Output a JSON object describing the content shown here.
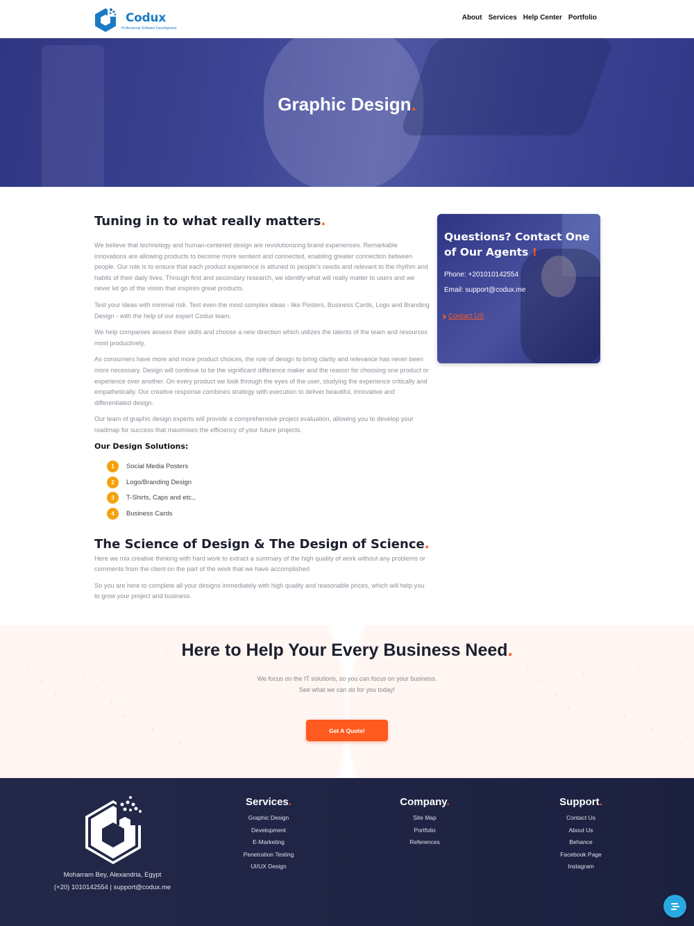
{
  "brand": {
    "name": "Codux",
    "tagline": "Professional Software Development",
    "accent": "#ff5a1f",
    "brand_blue": "#1a7bc4"
  },
  "nav": {
    "items": [
      "About",
      "Services",
      "Help Center",
      "Portfolio"
    ]
  },
  "hero": {
    "title": "Graphic Design",
    "dot": "."
  },
  "main": {
    "title": "Tuning in to what really matters",
    "paragraphs": [
      "We believe that technology and human-centered design are revolutionizing brand experiences. Remarkable innovations are allowing products to become more sentient and connected, enabling greater connection between people. Our role is to ensure that each product experience is attuned to people's needs and relevant to the rhythm and habits of their daily lives. Through first and secondary research, we identify what will really matter to users and we never let go of the vision that inspires great products.",
      "Test your ideas with minimal risk. Test even the most complex ideas - like Posters, Business Cards, Logo and Branding Design - with the help of our expert Codux team.",
      "We help companies assess their skills and choose a new direction which utilizes the talents of the team and resources most productively.",
      "As consumers have more and more product choices, the role of design to bring clarity and relevance has never been more necessary. Design will continue to be the significant difference maker and the reason for choosing one product or experience over another. On every product we look through the eyes of the user, studying the experience critically and empathetically. Our creative response combines strategy with execution to deliver beautiful, innovative and differentiated design.",
      "Our team of graphic design experts will provide a comprehensive project evaluation, allowing you to develop your roadmap for success that maximises the efficiency of your future projects."
    ],
    "solutions_title": "Our Design Solutions:",
    "solutions": [
      {
        "num": "1",
        "label": "Social Media Posters"
      },
      {
        "num": "2",
        "label": "Logo/Branding Design"
      },
      {
        "num": "3",
        "label": "T-Shirts, Caps and etc.,"
      },
      {
        "num": "4",
        "label": "Business Cards"
      }
    ],
    "section2_title": "The Science of Design & The Design of Science",
    "section2_paragraphs": [
      "Here we mix creative thinking with hard work to extract a summary of the high quality of work without any problems or comments from the client on the part of the work that we have accomplished",
      "So you are here to complete all your designs immediately with high quality and reasonable prices, which will help you to grow your project and business."
    ]
  },
  "card": {
    "title": "Questions? Contact One of Our Agents",
    "exclaim": "!",
    "phone": "Phone: +201010142554",
    "email": "Email: support@codux.me",
    "link": "Contact US"
  },
  "cta": {
    "title": "Here to Help Your Every Business Need",
    "line1": "We focus on the IT solutions, so you can focus on your business.",
    "line2": "See what we can do for you today!",
    "button": "Get A Quote!"
  },
  "footer": {
    "address": "Moharram Bey, Alexandria, Egypt",
    "phone": "(+20) 1010142554",
    "separator": "|",
    "email": "support@codux.me",
    "columns": [
      {
        "title": "Services",
        "items": [
          "Graphic Design",
          "Development",
          "E-Marketing",
          "Penetration Testing",
          "UI/UX Design"
        ]
      },
      {
        "title": "Company",
        "items": [
          "Site Map",
          "Portfolio",
          "References"
        ]
      },
      {
        "title": "Support",
        "items": [
          "Contact Us",
          "About Us",
          "Behance",
          "Facebook Page",
          "Instagram"
        ]
      }
    ]
  }
}
